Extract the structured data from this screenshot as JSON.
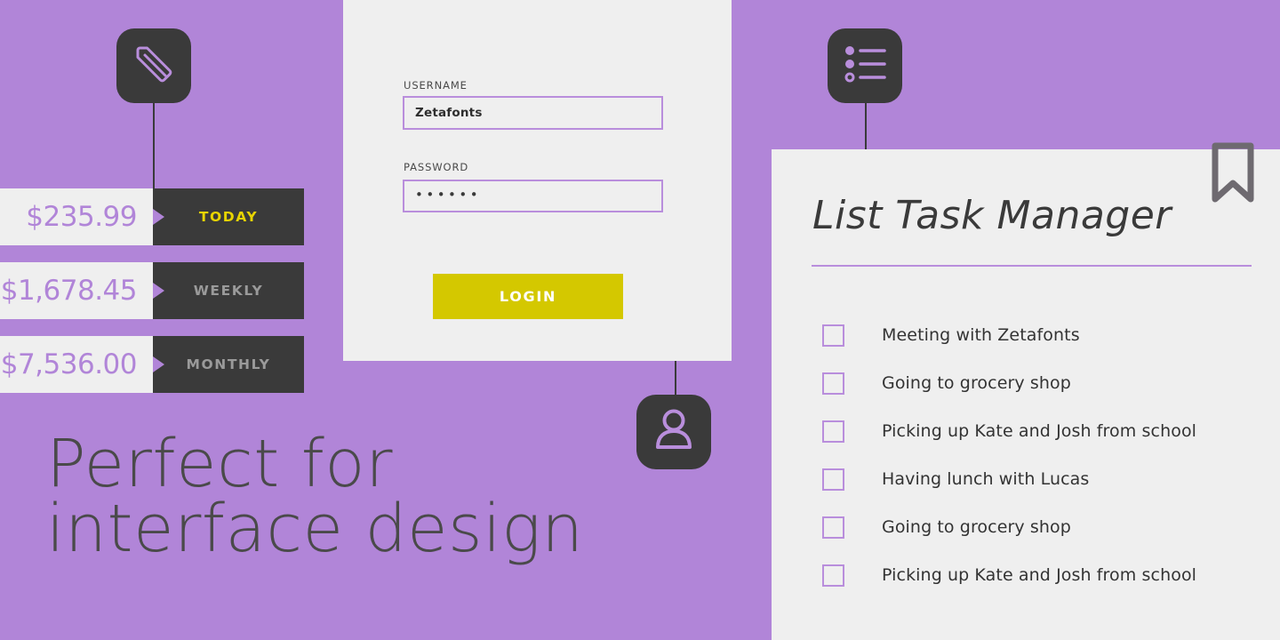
{
  "theme": {
    "background_purple": "#b185d8",
    "panel_light": "#efefef",
    "dark": "#3a3a3a",
    "accent_yellow": "#e8d400",
    "button_yellow": "#d4c800",
    "purple_accent": "#b98edc",
    "label_gray": "#9a9a9a"
  },
  "stats": {
    "rows": [
      {
        "amount": "$235.99",
        "label": "TODAY",
        "accent": true
      },
      {
        "amount": "$1,678.45",
        "label": "WEEKLY",
        "accent": false
      },
      {
        "amount": "$7,536.00",
        "label": "MONTHLY",
        "accent": false
      }
    ]
  },
  "icons": {
    "tag": "tag-icon",
    "list": "list-icon",
    "user": "user-icon",
    "bookmark": "bookmark-icon"
  },
  "login": {
    "username_label": "USERNAME",
    "username_value": "Zetafonts",
    "username_placeholder": "Username",
    "password_label": "PASSWORD",
    "password_value": "••••••",
    "password_placeholder": "Password",
    "submit_label": "LOGIN"
  },
  "tasks": {
    "title": "List Task Manager",
    "items": [
      {
        "text": "Meeting with Zetafonts",
        "checked": false
      },
      {
        "text": "Going to grocery shop",
        "checked": false
      },
      {
        "text": "Picking up Kate and Josh from school",
        "checked": false
      },
      {
        "text": "Having lunch with Lucas",
        "checked": false
      },
      {
        "text": "Going to grocery shop",
        "checked": false
      },
      {
        "text": "Picking up Kate and Josh from school",
        "checked": false
      }
    ]
  },
  "headline": {
    "line1": "Perfect for",
    "line2": "interface design"
  }
}
